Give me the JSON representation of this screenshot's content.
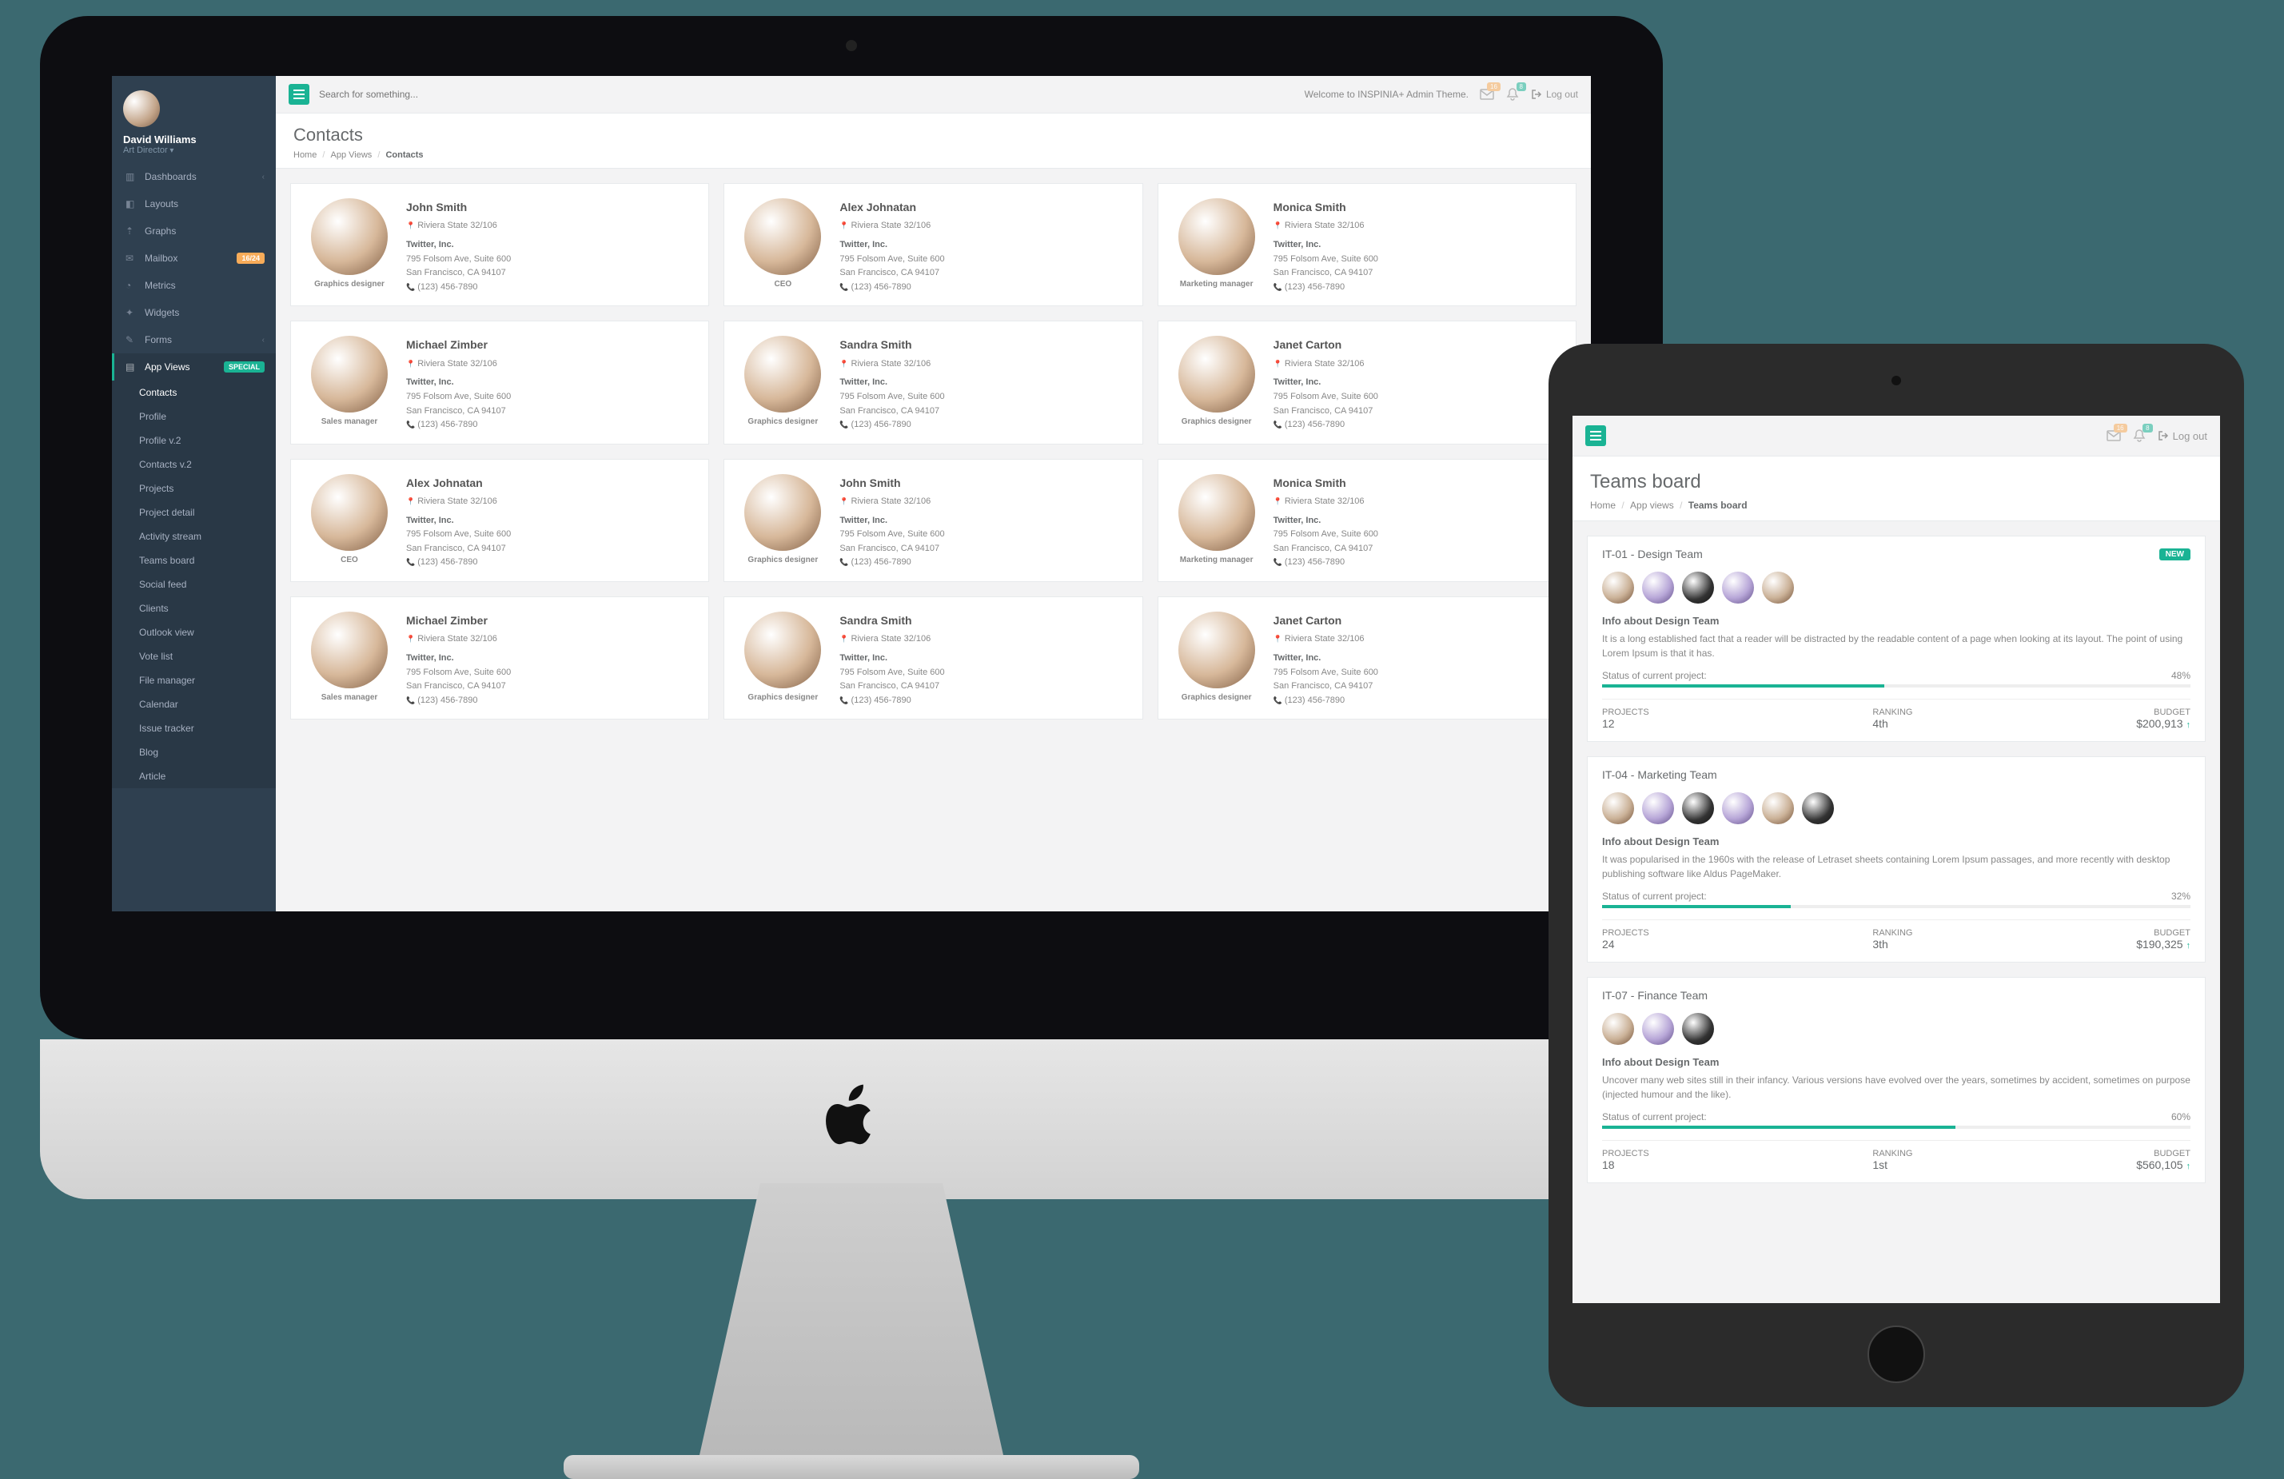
{
  "colors": {
    "primary": "#1ab394",
    "warning": "#f8ac59",
    "sidebar": "#2f4050"
  },
  "imac": {
    "user": {
      "name": "David Williams",
      "role": "Art Director"
    },
    "search_placeholder": "Search for something...",
    "welcome_text": "Welcome to INSPINIA+ Admin Theme.",
    "noti_mail_count": "16",
    "noti_bell_count": "8",
    "logout_label": "Log out",
    "page_title": "Contacts",
    "breadcrumb": [
      "Home",
      "App Views",
      "Contacts"
    ],
    "nav": [
      {
        "label": "Dashboards",
        "icon": "dashboard",
        "chev": true
      },
      {
        "label": "Layouts",
        "icon": "layout"
      },
      {
        "label": "Graphs",
        "icon": "chart"
      },
      {
        "label": "Mailbox",
        "icon": "mail",
        "badge": "16/24",
        "badge_style": "warn"
      },
      {
        "label": "Metrics",
        "icon": "metrics"
      },
      {
        "label": "Widgets",
        "icon": "widgets"
      },
      {
        "label": "Forms",
        "icon": "form",
        "chev": true
      },
      {
        "label": "App Views",
        "icon": "app",
        "badge": "SPECIAL",
        "badge_style": "ok",
        "active": true,
        "sub": [
          "Contacts",
          "Profile",
          "Profile v.2",
          "Contacts v.2",
          "Projects",
          "Project detail",
          "Activity stream",
          "Teams board",
          "Social feed",
          "Clients",
          "Outlook view",
          "Vote list",
          "File manager",
          "Calendar",
          "Issue tracker",
          "Blog",
          "Article"
        ],
        "sub_active": 0
      }
    ],
    "contacts": [
      {
        "name": "John Smith",
        "role": "Graphics designer",
        "loc": "Riviera State 32/106",
        "company": "Twitter, Inc.",
        "addr1": "795 Folsom Ave, Suite 600",
        "addr2": "San Francisco, CA 94107",
        "phone": "(123) 456-7890"
      },
      {
        "name": "Alex Johnatan",
        "role": "CEO",
        "loc": "Riviera State 32/106",
        "company": "Twitter, Inc.",
        "addr1": "795 Folsom Ave, Suite 600",
        "addr2": "San Francisco, CA 94107",
        "phone": "(123) 456-7890"
      },
      {
        "name": "Monica Smith",
        "role": "Marketing manager",
        "loc": "Riviera State 32/106",
        "company": "Twitter, Inc.",
        "addr1": "795 Folsom Ave, Suite 600",
        "addr2": "San Francisco, CA 94107",
        "phone": "(123) 456-7890"
      },
      {
        "name": "Michael Zimber",
        "role": "Sales manager",
        "loc": "Riviera State 32/106",
        "company": "Twitter, Inc.",
        "addr1": "795 Folsom Ave, Suite 600",
        "addr2": "San Francisco, CA 94107",
        "phone": "(123) 456-7890"
      },
      {
        "name": "Sandra Smith",
        "role": "Graphics designer",
        "loc": "Riviera State 32/106",
        "company": "Twitter, Inc.",
        "addr1": "795 Folsom Ave, Suite 600",
        "addr2": "San Francisco, CA 94107",
        "phone": "(123) 456-7890"
      },
      {
        "name": "Janet Carton",
        "role": "Graphics designer",
        "loc": "Riviera State 32/106",
        "company": "Twitter, Inc.",
        "addr1": "795 Folsom Ave, Suite 600",
        "addr2": "San Francisco, CA 94107",
        "phone": "(123) 456-7890"
      },
      {
        "name": "Alex Johnatan",
        "role": "CEO",
        "loc": "Riviera State 32/106",
        "company": "Twitter, Inc.",
        "addr1": "795 Folsom Ave, Suite 600",
        "addr2": "San Francisco, CA 94107",
        "phone": "(123) 456-7890"
      },
      {
        "name": "John Smith",
        "role": "Graphics designer",
        "loc": "Riviera State 32/106",
        "company": "Twitter, Inc.",
        "addr1": "795 Folsom Ave, Suite 600",
        "addr2": "San Francisco, CA 94107",
        "phone": "(123) 456-7890"
      },
      {
        "name": "Monica Smith",
        "role": "Marketing manager",
        "loc": "Riviera State 32/106",
        "company": "Twitter, Inc.",
        "addr1": "795 Folsom Ave, Suite 600",
        "addr2": "San Francisco, CA 94107",
        "phone": "(123) 456-7890"
      },
      {
        "name": "Michael Zimber",
        "role": "Sales manager",
        "loc": "Riviera State 32/106",
        "company": "Twitter, Inc.",
        "addr1": "795 Folsom Ave, Suite 600",
        "addr2": "San Francisco, CA 94107",
        "phone": "(123) 456-7890"
      },
      {
        "name": "Sandra Smith",
        "role": "Graphics designer",
        "loc": "Riviera State 32/106",
        "company": "Twitter, Inc.",
        "addr1": "795 Folsom Ave, Suite 600",
        "addr2": "San Francisco, CA 94107",
        "phone": "(123) 456-7890"
      },
      {
        "name": "Janet Carton",
        "role": "Graphics designer",
        "loc": "Riviera State 32/106",
        "company": "Twitter, Inc.",
        "addr1": "795 Folsom Ave, Suite 600",
        "addr2": "San Francisco, CA 94107",
        "phone": "(123) 456-7890"
      }
    ]
  },
  "ipad": {
    "logout_label": "Log out",
    "noti_mail_count": "16",
    "noti_bell_count": "8",
    "page_title": "Teams board",
    "breadcrumb": [
      "Home",
      "App views",
      "Teams board"
    ],
    "teams": [
      {
        "name": "IT-01 - Design Team",
        "badge": "NEW",
        "members": 5,
        "info_title": "Info about Design Team",
        "desc": "It is a long established fact that a reader will be distracted by the readable content of a page when looking at its layout. The point of using Lorem Ipsum is that it has.",
        "status_label": "Status of current project:",
        "progress": 48,
        "progress_label": "48%",
        "projects_label": "PROJECTS",
        "projects": "12",
        "ranking_label": "RANKING",
        "ranking": "4th",
        "budget_label": "BUDGET",
        "budget": "$200,913"
      },
      {
        "name": "IT-04 - Marketing Team",
        "badge": "",
        "members": 6,
        "info_title": "Info about Design Team",
        "desc": "It was popularised in the 1960s with the release of Letraset sheets containing Lorem Ipsum passages, and more recently with desktop publishing software like Aldus PageMaker.",
        "status_label": "Status of current project:",
        "progress": 32,
        "progress_label": "32%",
        "projects_label": "PROJECTS",
        "projects": "24",
        "ranking_label": "RANKING",
        "ranking": "3th",
        "budget_label": "BUDGET",
        "budget": "$190,325"
      },
      {
        "name": "IT-07 - Finance Team",
        "badge": "",
        "members": 3,
        "info_title": "Info about Design Team",
        "desc": "Uncover many web sites still in their infancy. Various versions have evolved over the years, sometimes by accident, sometimes on purpose (injected humour and the like).",
        "status_label": "Status of current project:",
        "progress": 60,
        "progress_label": "60%",
        "projects_label": "PROJECTS",
        "projects": "18",
        "ranking_label": "RANKING",
        "ranking": "1st",
        "budget_label": "BUDGET",
        "budget": "$560,105"
      }
    ]
  }
}
